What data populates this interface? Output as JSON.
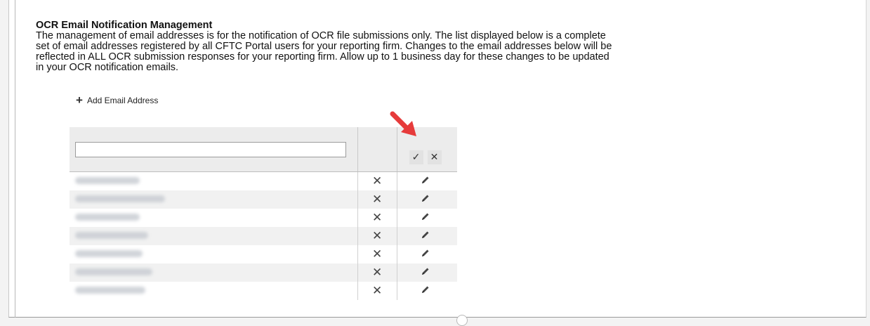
{
  "section": {
    "title": "OCR Email Notification Management",
    "description_lines": [
      "The management of email addresses is for the notification of OCR file submissions only. The list displayed below is a complete",
      "set of email addresses registered by all CFTC Portal users for your reporting firm. Changes to the email addresses below will be",
      "reflected in ALL OCR submission responses for your reporting firm. Allow up to 1 business day for these changes to be updated",
      "in your OCR notification emails."
    ]
  },
  "toolbar": {
    "add_label": "Add Email Address",
    "add_icon": "plus-icon"
  },
  "edit_row": {
    "input_value": "",
    "save_icon": "checkmark-icon",
    "cancel_icon": "close-icon"
  },
  "rows": [
    {
      "email": "",
      "delete_icon": "close-icon",
      "edit_icon": "pencil-icon"
    },
    {
      "email": "",
      "delete_icon": "close-icon",
      "edit_icon": "pencil-icon"
    },
    {
      "email": "",
      "delete_icon": "close-icon",
      "edit_icon": "pencil-icon"
    },
    {
      "email": "",
      "delete_icon": "close-icon",
      "edit_icon": "pencil-icon"
    },
    {
      "email": "",
      "delete_icon": "close-icon",
      "edit_icon": "pencil-icon"
    },
    {
      "email": "",
      "delete_icon": "close-icon",
      "edit_icon": "pencil-icon"
    },
    {
      "email": "",
      "delete_icon": "close-icon",
      "edit_icon": "pencil-icon"
    }
  ],
  "colors": {
    "arrow": "#e63b3b",
    "header_bg": "#ececec",
    "stripe": "#f1f1f1"
  },
  "glyphs": {
    "check": "✓",
    "close": "✕",
    "plus": "+"
  }
}
